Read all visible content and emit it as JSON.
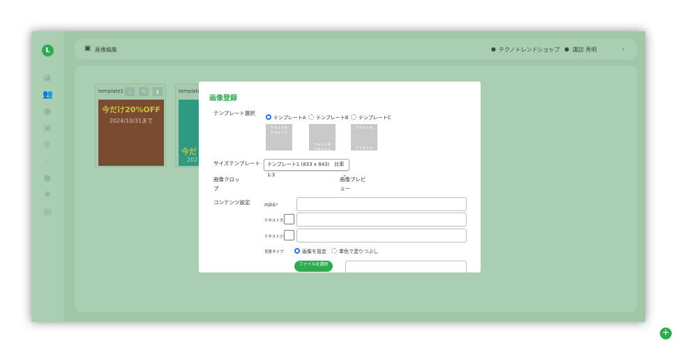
{
  "sidebar": {
    "logo": "L",
    "icons": [
      "pie-chart-icon",
      "users-icon",
      "chat-icon",
      "image-icon",
      "table-icon",
      "qr-icon",
      "user-icon",
      "gear-icon",
      "store-icon"
    ]
  },
  "header": {
    "title": "画像編集",
    "shop": "テクノトレンドショップ",
    "user": "諏訪 秀明"
  },
  "cards": [
    {
      "name": "template1",
      "headline": "今だけ20%OFF",
      "date": "2024/10/31まで",
      "bg": "#7a4a32"
    },
    {
      "name": "template",
      "headline": "今だ",
      "date": "202",
      "bg": "#2e9a82"
    }
  ],
  "modal": {
    "title": "画像登録",
    "template_label": "テンプレート選択",
    "templates": [
      {
        "label": "テンプレートA",
        "selected": true,
        "top": "テキスト大",
        "sub": "テキスト小"
      },
      {
        "label": "テンプレートB",
        "selected": false,
        "top": "テキスト大",
        "sub": "テキスト小"
      },
      {
        "label": "テンプレートC",
        "selected": false,
        "top": "テキスト大",
        "sub": "テキスト小"
      }
    ],
    "size_label": "サイズテンプレート",
    "size_value": "テンプレート1 (833 x 843)　比率1:3",
    "crop_label": "画像クロップ",
    "preview_label": "画像プレビュー",
    "content_label": "コンテンツ設定",
    "name_label": "内部名*",
    "text_large_label": "テキスト大",
    "text_small_label": "テキスト小",
    "bg_type_label": "背景タイプ",
    "bg_options": [
      {
        "label": "画像を設定",
        "selected": true
      },
      {
        "label": "単色で塗りつぶし",
        "selected": false
      }
    ],
    "file_button": "ファイルを選択"
  },
  "accent": "#2eab4f"
}
